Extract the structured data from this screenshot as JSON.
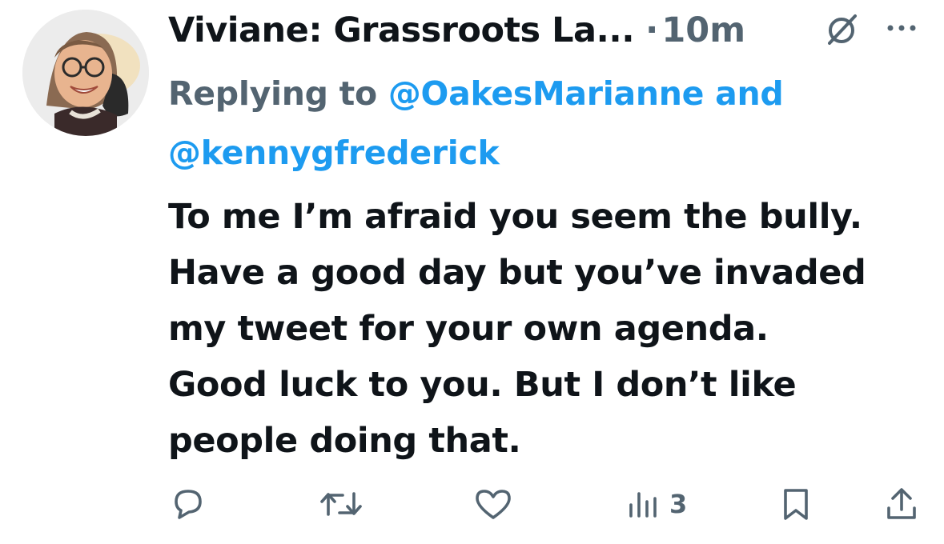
{
  "tweet": {
    "author_name": "Viviane: Grassroots La...",
    "separator": "·",
    "timestamp": "10m",
    "replying_prefix": "Replying to",
    "mention_1": "@OakesMarianne",
    "mention_join": "and",
    "mention_2": "@kennygfrederick",
    "body_lines": [
      "To me I’m afraid you seem the bully.",
      "Have a good day but you’ve invaded",
      "my tweet for your own agenda.",
      "Good luck to you. But I don’t like",
      "people doing that."
    ]
  },
  "actions": {
    "views_count": "3"
  },
  "icons": {
    "avatar": "avatar",
    "grok": "grok-icon",
    "more": "more-icon",
    "reply": "reply-icon",
    "retweet": "retweet-icon",
    "like": "like-icon",
    "views": "views-icon",
    "bookmark": "bookmark-icon",
    "share": "share-icon"
  },
  "colors": {
    "text": "#0f1419",
    "secondary": "#536471",
    "link": "#1d9bf0"
  }
}
